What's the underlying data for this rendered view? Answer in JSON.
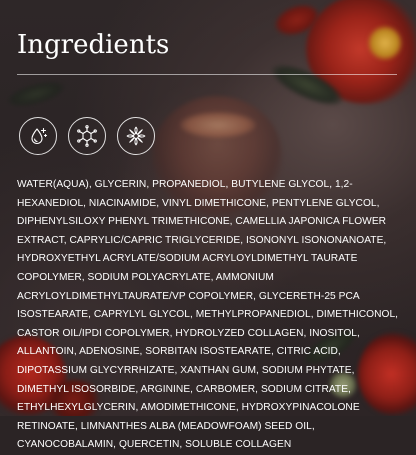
{
  "title": "Ingredients",
  "icons": [
    {
      "name": "water-drop-sparkle-icon"
    },
    {
      "name": "molecule-icon"
    },
    {
      "name": "flower-icon"
    }
  ],
  "ingredients_text": "WATER(AQUA), GLYCERIN, PROPANEDIOL, BUTYLENE GLYCOL, 1,2-HEXANEDIOL, NIACINAMIDE, VINYL DIMETHICONE, PENTYLENE GLYCOL, DIPHENYLSILOXY PHENYL TRIMETHICONE, CAMELLIA JAPONICA FLOWER EXTRACT, CAPRYLIC/CAPRIC TRIGLYCERIDE, ISONONYL ISONONANOATE, HYDROXYETHYL ACRYLATE/SODIUM ACRYLOYLDIMETHYL TAURATE COPOLYMER, SODIUM POLYACRYLATE, AMMONIUM ACRYLOYLDIMETHYLTAURATE/VP COPOLYMER, GLYCERETH-25 PCA ISOSTEARATE, CAPRYLYL GLYCOL, METHYLPROPANEDIOL, DIMETHICONOL, CASTOR OIL/IPDI COPOLYMER, HYDROLYZED COLLAGEN, INOSITOL, ALLANTOIN, ADENOSINE, SORBITAN ISOSTEARATE, CITRIC ACID, DIPOTASSIUM GLYCYRRHIZATE, XANTHAN GUM, SODIUM PHYTATE, DIMETHYL ISOSORBIDE, ARGININE, CARBOMER, SODIUM CITRATE, ETHYLHEXYLGLYCERIN, AMODIMETHICONE, HYDROXYPINACOLONE RETINOATE, LIMNANTHES ALBA (MEADOWFOAM) SEED OIL, CYANOCOBALAMIN, QUERCETIN, SOLUBLE COLLAGEN",
  "colors": {
    "background": "#2b2425",
    "text": "#ffffff",
    "accent_flower": "#b1271d"
  }
}
